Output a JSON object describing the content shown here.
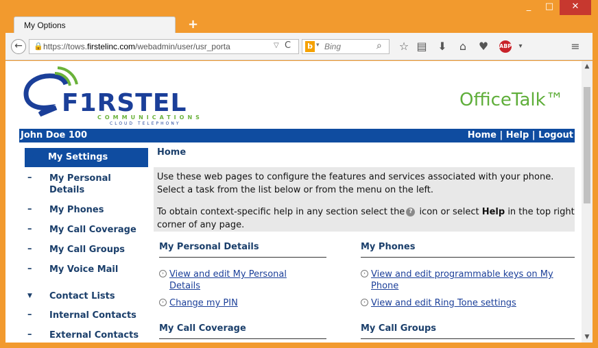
{
  "browser": {
    "tab_title": "My Options",
    "new_tab": "+",
    "window_controls": {
      "minimize": "_",
      "maximize": "□",
      "close": "✕"
    },
    "url_host": "https://tows.",
    "url_domain": "firstelinc.com",
    "url_path": "/webadmin/user/usr_porta",
    "search_placeholder": "Bing",
    "toolbar_icons": [
      "star-icon",
      "reading-list-icon",
      "download-icon",
      "home-icon",
      "pocket-icon",
      "adblock-icon",
      "menu-icon"
    ],
    "adblock_label": "ABP"
  },
  "header": {
    "brand": "F1RSTEL",
    "brand_sub": "COMMUNICATIONS",
    "brand_sub2": "CLOUD TELEPHONY",
    "product": "OfficeTalk™"
  },
  "userbar": {
    "user": "John Doe 100",
    "home": "Home",
    "help": "Help",
    "logout": "Logout",
    "sep": "|"
  },
  "sidebar": {
    "active": "My Settings",
    "items": [
      {
        "label": "My Personal Details"
      },
      {
        "label": "My Phones"
      },
      {
        "label": "My Call Coverage"
      },
      {
        "label": "My Call Groups"
      },
      {
        "label": "My Voice Mail"
      }
    ],
    "category": "Contact Lists",
    "contacts": [
      {
        "label": "Internal Contacts"
      },
      {
        "label": "External Contacts"
      }
    ]
  },
  "main": {
    "title": "Home",
    "intro1": "Use these web pages to configure the features and services associated with your phone. Select a task from the list below or from the menu on the left.",
    "intro2_a": "To obtain context-specific help in any section select the",
    "intro2_b": " icon or select ",
    "intro2_help": "Help",
    "intro2_c": " in the top right corner of any page.",
    "sections": {
      "personal": {
        "title": "My Personal Details",
        "links": [
          "View and edit My Personal Details",
          "Change my PIN"
        ]
      },
      "phones": {
        "title": "My Phones",
        "links": [
          "View and edit programmable keys on My Phone",
          "View and edit Ring Tone settings"
        ]
      },
      "coverage": {
        "title": "My Call Coverage"
      },
      "groups": {
        "title": "My Call Groups"
      }
    }
  },
  "colors": {
    "accent": "#0f4ca0",
    "brand_green": "#5fae3a",
    "frame": "#f29a2e"
  }
}
